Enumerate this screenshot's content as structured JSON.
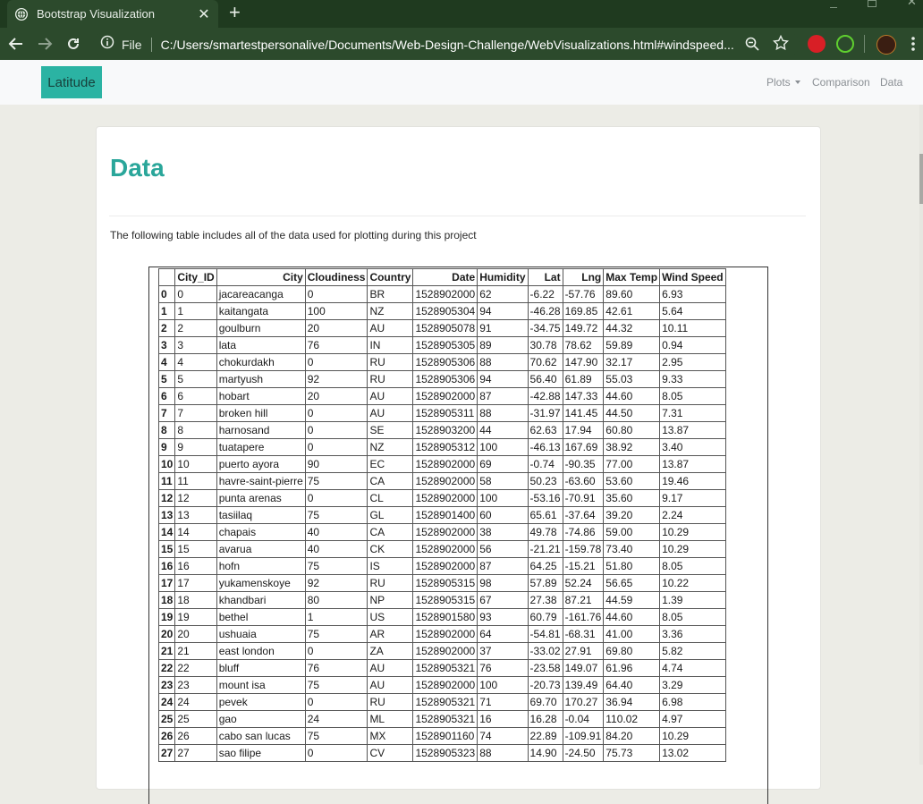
{
  "browser": {
    "tab_title": "Bootstrap Visualization",
    "tab_close": "✕",
    "new_tab": "+",
    "url_scheme": "File",
    "url": "C:/Users/smartestpersonalive/Documents/Web-Design-Challenge/WebVisualizations.html#windspeed..."
  },
  "navbar": {
    "brand": "Latitude",
    "links": [
      "Plots",
      "Comparison",
      "Data"
    ]
  },
  "page": {
    "heading": "Data",
    "description": "The following table includes all of the data used for plotting during this project"
  },
  "table": {
    "headers": [
      "",
      "City_ID",
      "City",
      "Cloudiness",
      "Country",
      "Date",
      "Humidity",
      "Lat",
      "Lng",
      "Max Temp",
      "Wind Speed"
    ],
    "rows": [
      [
        "0",
        "0",
        "jacareacanga",
        "0",
        "BR",
        "1528902000",
        "62",
        "-6.22",
        "-57.76",
        "89.60",
        "6.93"
      ],
      [
        "1",
        "1",
        "kaitangata",
        "100",
        "NZ",
        "1528905304",
        "94",
        "-46.28",
        "169.85",
        "42.61",
        "5.64"
      ],
      [
        "2",
        "2",
        "goulburn",
        "20",
        "AU",
        "1528905078",
        "91",
        "-34.75",
        "149.72",
        "44.32",
        "10.11"
      ],
      [
        "3",
        "3",
        "lata",
        "76",
        "IN",
        "1528905305",
        "89",
        "30.78",
        "78.62",
        "59.89",
        "0.94"
      ],
      [
        "4",
        "4",
        "chokurdakh",
        "0",
        "RU",
        "1528905306",
        "88",
        "70.62",
        "147.90",
        "32.17",
        "2.95"
      ],
      [
        "5",
        "5",
        "martyush",
        "92",
        "RU",
        "1528905306",
        "94",
        "56.40",
        "61.89",
        "55.03",
        "9.33"
      ],
      [
        "6",
        "6",
        "hobart",
        "20",
        "AU",
        "1528902000",
        "87",
        "-42.88",
        "147.33",
        "44.60",
        "8.05"
      ],
      [
        "7",
        "7",
        "broken hill",
        "0",
        "AU",
        "1528905311",
        "88",
        "-31.97",
        "141.45",
        "44.50",
        "7.31"
      ],
      [
        "8",
        "8",
        "harnosand",
        "0",
        "SE",
        "1528903200",
        "44",
        "62.63",
        "17.94",
        "60.80",
        "13.87"
      ],
      [
        "9",
        "9",
        "tuatapere",
        "0",
        "NZ",
        "1528905312",
        "100",
        "-46.13",
        "167.69",
        "38.92",
        "3.40"
      ],
      [
        "10",
        "10",
        "puerto ayora",
        "90",
        "EC",
        "1528902000",
        "69",
        "-0.74",
        "-90.35",
        "77.00",
        "13.87"
      ],
      [
        "11",
        "11",
        "havre-saint-pierre",
        "75",
        "CA",
        "1528902000",
        "58",
        "50.23",
        "-63.60",
        "53.60",
        "19.46"
      ],
      [
        "12",
        "12",
        "punta arenas",
        "0",
        "CL",
        "1528902000",
        "100",
        "-53.16",
        "-70.91",
        "35.60",
        "9.17"
      ],
      [
        "13",
        "13",
        "tasiilaq",
        "75",
        "GL",
        "1528901400",
        "60",
        "65.61",
        "-37.64",
        "39.20",
        "2.24"
      ],
      [
        "14",
        "14",
        "chapais",
        "40",
        "CA",
        "1528902000",
        "38",
        "49.78",
        "-74.86",
        "59.00",
        "10.29"
      ],
      [
        "15",
        "15",
        "avarua",
        "40",
        "CK",
        "1528902000",
        "56",
        "-21.21",
        "-159.78",
        "73.40",
        "10.29"
      ],
      [
        "16",
        "16",
        "hofn",
        "75",
        "IS",
        "1528902000",
        "87",
        "64.25",
        "-15.21",
        "51.80",
        "8.05"
      ],
      [
        "17",
        "17",
        "yukamenskoye",
        "92",
        "RU",
        "1528905315",
        "98",
        "57.89",
        "52.24",
        "56.65",
        "10.22"
      ],
      [
        "18",
        "18",
        "khandbari",
        "80",
        "NP",
        "1528905315",
        "67",
        "27.38",
        "87.21",
        "44.59",
        "1.39"
      ],
      [
        "19",
        "19",
        "bethel",
        "1",
        "US",
        "1528901580",
        "93",
        "60.79",
        "-161.76",
        "44.60",
        "8.05"
      ],
      [
        "20",
        "20",
        "ushuaia",
        "75",
        "AR",
        "1528902000",
        "64",
        "-54.81",
        "-68.31",
        "41.00",
        "3.36"
      ],
      [
        "21",
        "21",
        "east london",
        "0",
        "ZA",
        "1528902000",
        "37",
        "-33.02",
        "27.91",
        "69.80",
        "5.82"
      ],
      [
        "22",
        "22",
        "bluff",
        "76",
        "AU",
        "1528905321",
        "76",
        "-23.58",
        "149.07",
        "61.96",
        "4.74"
      ],
      [
        "23",
        "23",
        "mount isa",
        "75",
        "AU",
        "1528902000",
        "100",
        "-20.73",
        "139.49",
        "64.40",
        "3.29"
      ],
      [
        "24",
        "24",
        "pevek",
        "0",
        "RU",
        "1528905321",
        "71",
        "69.70",
        "170.27",
        "36.94",
        "6.98"
      ],
      [
        "25",
        "25",
        "gao",
        "24",
        "ML",
        "1528905321",
        "16",
        "16.28",
        "-0.04",
        "110.02",
        "4.97"
      ],
      [
        "26",
        "26",
        "cabo san lucas",
        "75",
        "MX",
        "1528901160",
        "74",
        "22.89",
        "-109.91",
        "84.20",
        "10.29"
      ],
      [
        "27",
        "27",
        "sao filipe",
        "0",
        "CV",
        "1528905323",
        "88",
        "14.90",
        "-24.50",
        "75.73",
        "13.02"
      ]
    ]
  }
}
